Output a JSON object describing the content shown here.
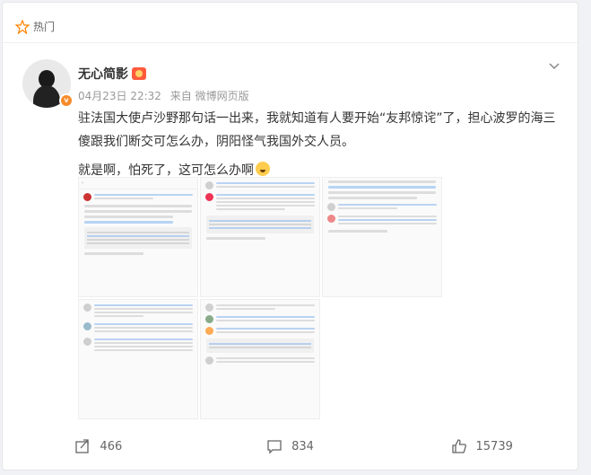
{
  "header": {
    "label": "热门"
  },
  "post": {
    "author": "无心简影",
    "date": "04月23日 22:32",
    "source": "来自 微博网页版",
    "text_1": "驻法国大使卢沙野那句话一出来，我就知道有人要开始“友邦惊诧”了，担心波罗的海三傻跟我们断交可怎么办，阴阳怪气我国外交人员。",
    "text_2": "就是啊，怕死了，这可怎么办啊"
  },
  "actions": {
    "repost_count": "466",
    "comment_count": "834",
    "like_count": "15739"
  },
  "icons": {
    "hot": "hot-badge-icon",
    "chevron": "chevron-down-icon",
    "repost": "share-icon",
    "comment": "comment-icon",
    "like": "thumbs-up-icon"
  },
  "colors": {
    "accent": "#ff8200",
    "verify": "#f78b2a",
    "link": "#eb7350"
  }
}
